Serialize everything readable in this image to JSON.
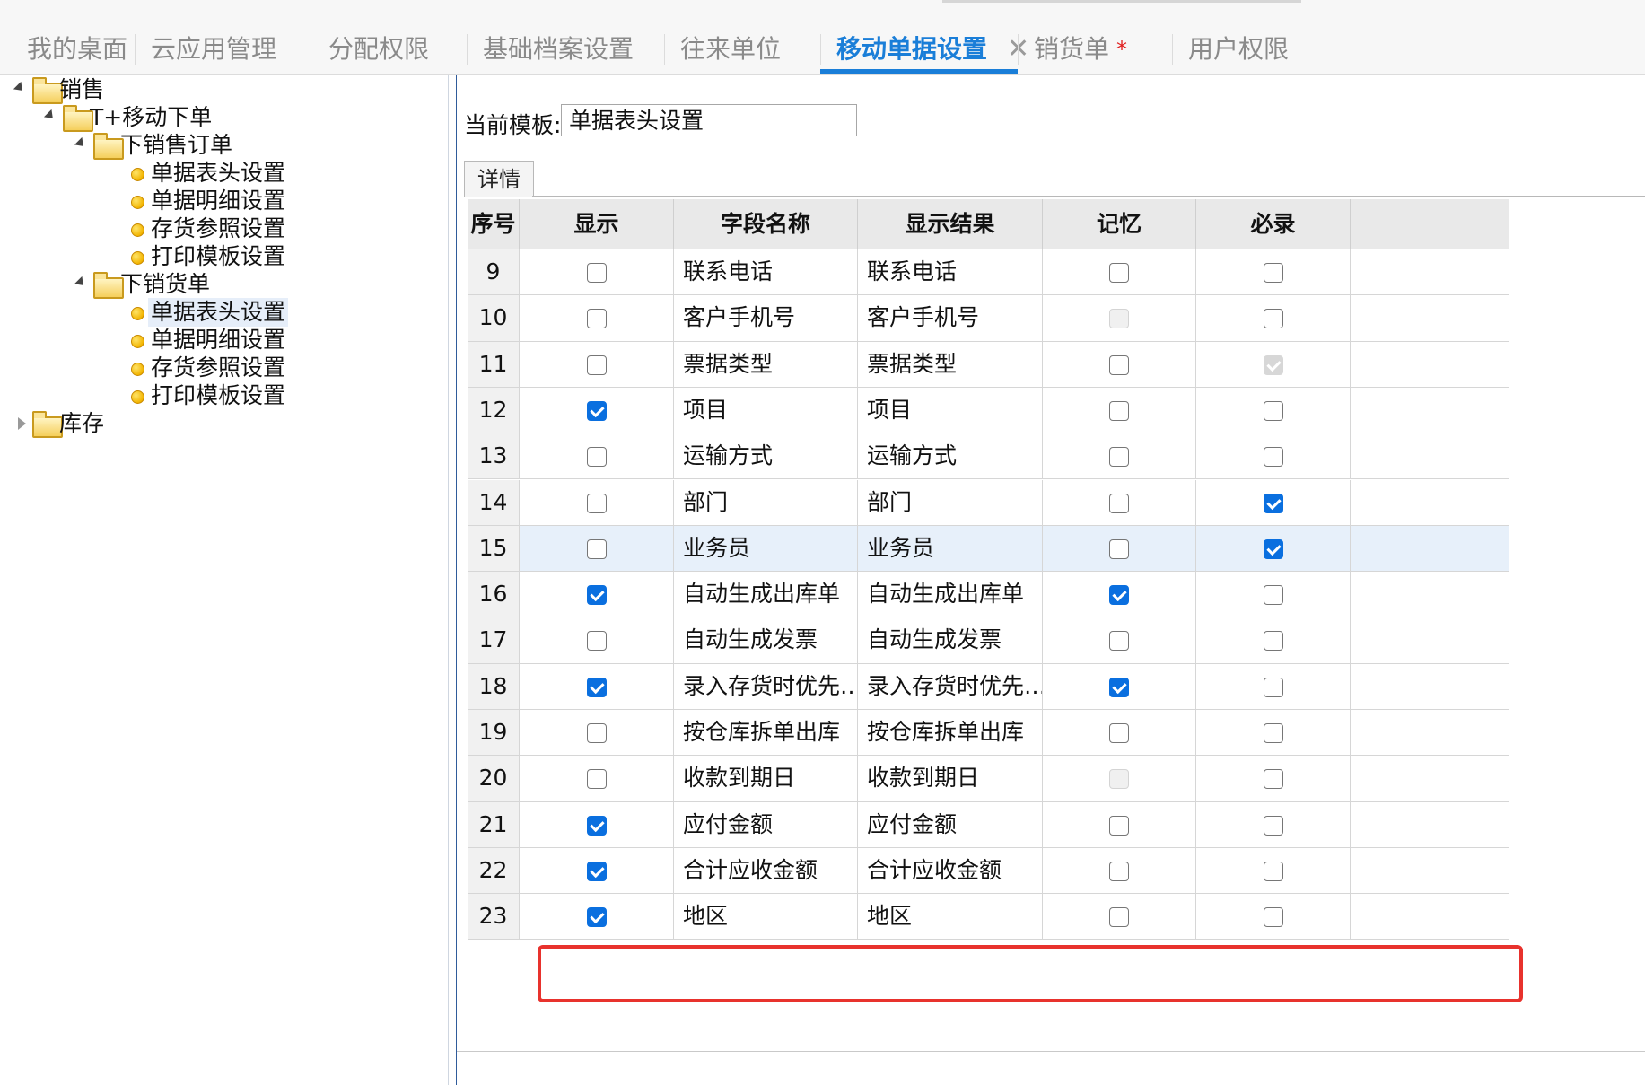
{
  "tabs": [
    {
      "label": "我的桌面",
      "active": false
    },
    {
      "label": "云应用管理",
      "active": false
    },
    {
      "label": "分配权限",
      "active": false
    },
    {
      "label": "基础档案设置",
      "active": false
    },
    {
      "label": "往来单位",
      "active": false
    },
    {
      "label": "移动单据设置",
      "active": true,
      "close": "✕"
    },
    {
      "label": "销货单",
      "active": false,
      "modified": "*"
    },
    {
      "label": "用户权限",
      "active": false
    }
  ],
  "tree": {
    "root_sales": "销售",
    "t_mobile": "T+移动下单",
    "sales_order": "下销售订单",
    "so_items": [
      "单据表头设置",
      "单据明细设置",
      "存货参照设置",
      "打印模板设置"
    ],
    "sales_delivery": "下销货单",
    "sd_items": [
      "单据表头设置",
      "单据明细设置",
      "存货参照设置",
      "打印模板设置"
    ],
    "root_inventory": "库存"
  },
  "main": {
    "template_label": "当前模板:",
    "template_value": "单据表头设置",
    "subtab": "详情"
  },
  "grid": {
    "headers": [
      "序号",
      "显示",
      "字段名称",
      "显示结果",
      "记忆",
      "必录"
    ],
    "rows": [
      {
        "no": "9",
        "show": false,
        "field": "联系电话",
        "result": "联系电话",
        "memory": false,
        "required": false
      },
      {
        "no": "10",
        "show": false,
        "field": "客户手机号",
        "result": "客户手机号",
        "memory": false,
        "memory_disabled": true,
        "required": false
      },
      {
        "no": "11",
        "show": false,
        "field": "票据类型",
        "result": "票据类型",
        "memory": false,
        "required": true,
        "required_disabled": true
      },
      {
        "no": "12",
        "show": true,
        "field": "项目",
        "result": "项目",
        "memory": false,
        "required": false
      },
      {
        "no": "13",
        "show": false,
        "field": "运输方式",
        "result": "运输方式",
        "memory": false,
        "required": false
      },
      {
        "no": "14",
        "show": false,
        "field": "部门",
        "result": "部门",
        "memory": false,
        "required": true
      },
      {
        "no": "15",
        "show": false,
        "field": "业务员",
        "result": "业务员",
        "memory": false,
        "required": true,
        "highlight": true
      },
      {
        "no": "16",
        "show": true,
        "field": "自动生成出库单",
        "result": "自动生成出库单",
        "memory": true,
        "required": false
      },
      {
        "no": "17",
        "show": false,
        "field": "自动生成发票",
        "result": "自动生成发票",
        "memory": false,
        "required": false
      },
      {
        "no": "18",
        "show": true,
        "field": "录入存货时优先…",
        "result": "录入存货时优先…",
        "memory": true,
        "required": false
      },
      {
        "no": "19",
        "show": false,
        "field": "按仓库拆单出库",
        "result": "按仓库拆单出库",
        "memory": false,
        "required": false
      },
      {
        "no": "20",
        "show": false,
        "field": "收款到期日",
        "result": "收款到期日",
        "memory": false,
        "memory_disabled": true,
        "required": false
      },
      {
        "no": "21",
        "show": true,
        "field": "应付金额",
        "result": "应付金额",
        "memory": false,
        "required": false
      },
      {
        "no": "22",
        "show": true,
        "field": "合计应收金额",
        "result": "合计应收金额",
        "memory": false,
        "required": false
      },
      {
        "no": "23",
        "show": true,
        "field": "地区",
        "result": "地区",
        "memory": false,
        "required": false
      }
    ]
  },
  "colors": {
    "accent": "#1a7ed8",
    "check": "#0a6fdf",
    "annotation": "#e8322d"
  }
}
